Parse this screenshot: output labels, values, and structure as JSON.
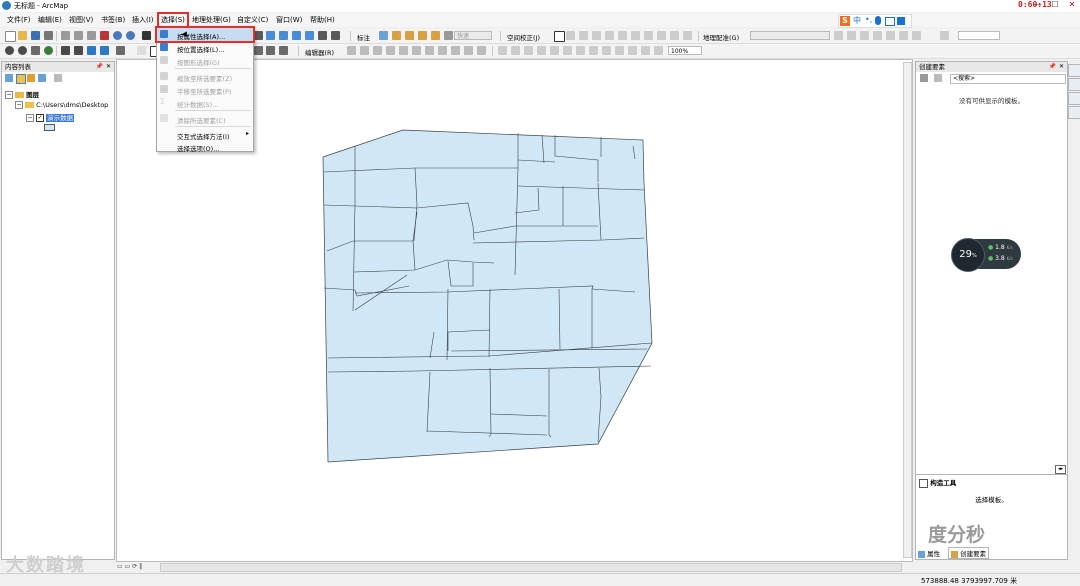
{
  "window": {
    "title": "无标题 - ArcMap",
    "timer": "0:60:13",
    "minimize": "—",
    "maximize": "☐",
    "close": "✕"
  },
  "menubar": {
    "items": [
      {
        "label": "文件(F)"
      },
      {
        "label": "编辑(E)"
      },
      {
        "label": "视图(V)"
      },
      {
        "label": "书签(B)"
      },
      {
        "label": "插入(I)"
      },
      {
        "label": "选择(S)"
      },
      {
        "label": "地理处理(G)"
      },
      {
        "label": "自定义(C)"
      },
      {
        "label": "窗口(W)"
      },
      {
        "label": "帮助(H)"
      }
    ]
  },
  "selection_menu": {
    "items": [
      {
        "label": "按属性选择(A)...",
        "state": "highlighted"
      },
      {
        "label": "按位置选择(L)...",
        "state": "enabled"
      },
      {
        "label": "按图形选择(G)",
        "state": "disabled"
      },
      {
        "label": "缩放至所选要素(Z)",
        "state": "disabled"
      },
      {
        "label": "平移至所选要素(P)",
        "state": "disabled"
      },
      {
        "label": "统计数据(S)...",
        "state": "disabled"
      },
      {
        "label": "清除所选要素(C)",
        "state": "disabled"
      },
      {
        "label": "交互式选择方法(I)",
        "state": "enabled",
        "submenu": "▸"
      },
      {
        "label": "选择选项(O)...",
        "state": "enabled"
      }
    ]
  },
  "toolbar": {
    "label_tool": "标注",
    "quick_combo": "快速",
    "spatial_adjust": "空间校正(J)",
    "editor": "编辑器(R)",
    "georeference": "地理配准(G)",
    "zoom_combo": "100%"
  },
  "toc": {
    "title": "内容列表",
    "layers_label": "图层",
    "folder": "C:\\Users\\dms\\Desktop",
    "layer_name": "演示数据"
  },
  "create_features": {
    "title": "创建要素",
    "search_placeholder": "<搜索>",
    "empty_message": "没有可供显示的模板。",
    "construction_title": "构造工具",
    "construction_message": "选择模板。",
    "tab_attributes": "属性",
    "tab_create": "创建要素"
  },
  "speed_widget": {
    "percent": "29",
    "unit": "%",
    "up": "1.8",
    "down": "3.8",
    "rate_unit": "K/s"
  },
  "statusbar": {
    "coordinates": "573888.48  3793997.709 米"
  },
  "watermarks": {
    "left": "大数踏境",
    "right": "度分秒"
  },
  "colors": {
    "parcel_fill": "#d0e8f5",
    "parcel_stroke": "#3a3f46",
    "highlight_outline": "#e0302a",
    "menu_highlight": "#c6dcf2"
  }
}
